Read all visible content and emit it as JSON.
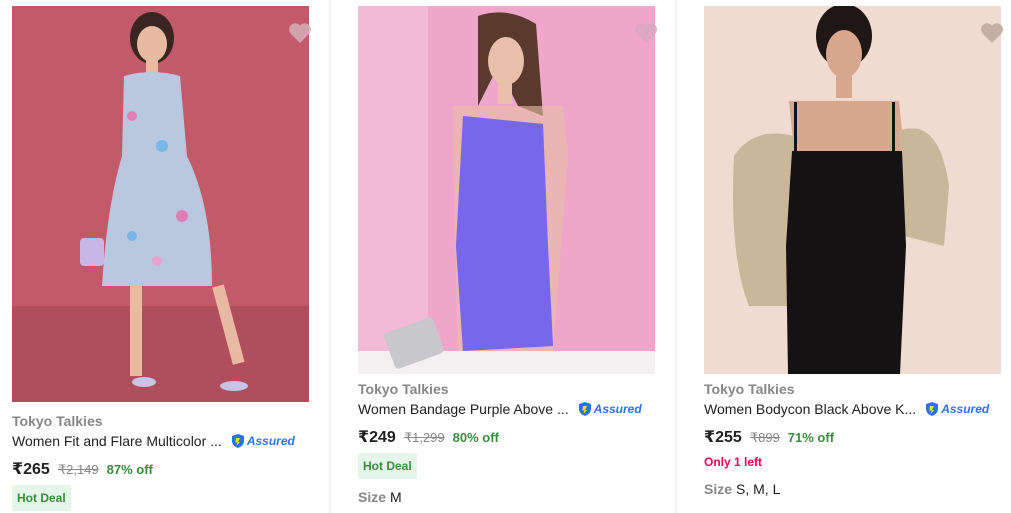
{
  "colors": {
    "accent": "#2874f0",
    "discount_green": "#388e3c",
    "urgency_pink": "#ff0054",
    "muted": "#878787"
  },
  "products": [
    {
      "brand": "Tokyo Talkies",
      "title": "Women Fit and Flare Multicolor ...",
      "assured_label": "Assured",
      "price": "₹265",
      "mrp": "₹2,149",
      "discount": "87% off",
      "badge": "Hot Deal",
      "wishlist_icon": "heart-icon"
    },
    {
      "brand": "Tokyo Talkies",
      "title": "Women Bandage Purple Above ...",
      "assured_label": "Assured",
      "price": "₹249",
      "mrp": "₹1,299",
      "discount": "80% off",
      "badge": "Hot Deal",
      "size_label": "Size",
      "sizes": "M",
      "wishlist_icon": "heart-icon"
    },
    {
      "brand": "Tokyo Talkies",
      "title": "Women Bodycon Black Above K...",
      "assured_label": "Assured",
      "price": "₹255",
      "mrp": "₹899",
      "discount": "71% off",
      "stock_note": "Only 1 left",
      "size_label": "Size",
      "sizes": "S, M, L",
      "wishlist_icon": "heart-icon"
    }
  ]
}
